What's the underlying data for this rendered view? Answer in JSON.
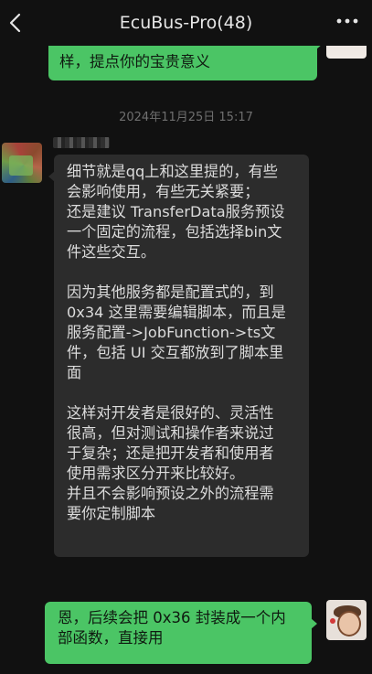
{
  "header": {
    "title": "EcuBus-Pro(48)",
    "back_icon": "chevron-left-icon",
    "more_icon": "more-dots-icon"
  },
  "messages": [
    {
      "side": "me",
      "text": "样，提点你的宝贵意义"
    },
    {
      "side": "peer",
      "paragraphs": [
        "细节就是qq上和这里提的，有些\n会影响使用，有些无关紧要；\n还是建议 TransferData服务预设\n一个固定的流程，包括选择bin文\n件这些交互。",
        "因为其他服务都是配置式的，到\n0x34 这里需要编辑脚本，而且是\n服务配置->JobFunction->ts文\n件，包括 UI 交互都放到了脚本里\n面",
        "这样对开发者是很好的、灵活性\n很高，但对测试和操作者来说过\n于复杂；还是把开发者和使用者\n使用需求区分开来比较好。\n并且不会影响预设之外的流程需\n要你定制脚本"
      ]
    },
    {
      "side": "me",
      "text": "恩，后续会把 0x36 封装成一个内\n部函数，直接用"
    }
  ],
  "timestamp": "2024年11月25日 15:17",
  "colors": {
    "background": "#111111",
    "my_bubble": "#4bc565",
    "peer_bubble": "#2c2c2c"
  }
}
